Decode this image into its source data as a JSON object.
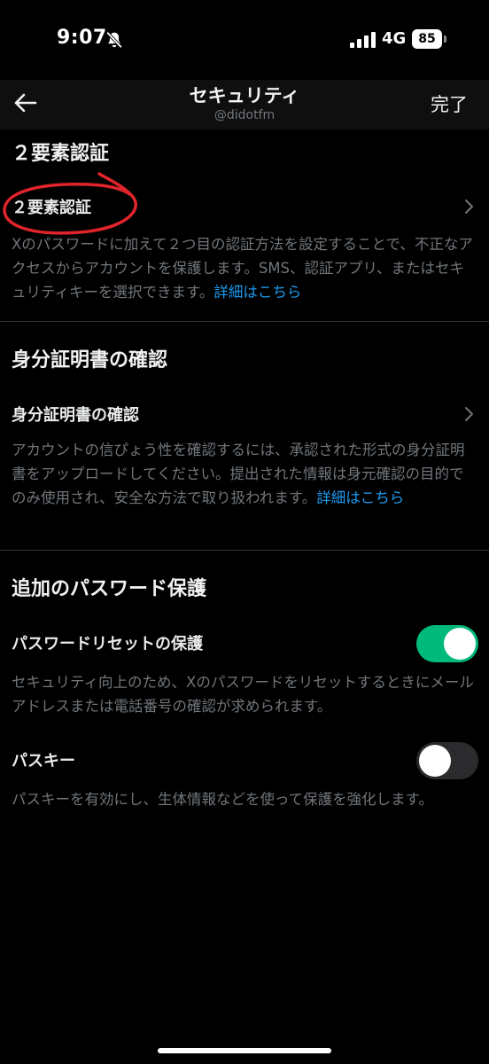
{
  "status_bar": {
    "time": "9:07",
    "network": "4G",
    "battery": "85"
  },
  "header": {
    "title": "セキュリティ",
    "username": "@didotfm",
    "done_label": "完了",
    "back_icon": "arrow-left-icon"
  },
  "two_factor": {
    "section_title": "２要素認証",
    "row_label": "２要素認証",
    "description": "Xのパスワードに加えて２つ目の認証方法を設定することで、不正なアクセスからアカウントを保護します。SMS、認証アプリ、またはセキュリティキーを選択できます。",
    "link": "詳細はこちら"
  },
  "id_verification": {
    "section_title": "身分証明書の確認",
    "row_label": "身分証明書の確認",
    "description": "アカウントの信ぴょう性を確認するには、承認された形式の身分証明書をアップロードしてください。提出された情報は身元確認の目的でのみ使用され、安全な方法で取り扱われます。",
    "link": "詳細はこちら"
  },
  "password_protection": {
    "section_title": "追加のパスワード保護",
    "reset_protection": {
      "label": "パスワードリセットの保護",
      "description": "セキュリティ向上のため、Xのパスワードをリセットするときにメールアドレスまたは電話番号の確認が求められます。",
      "enabled": true
    },
    "passkey": {
      "label": "パスキー",
      "description": "パスキーを有効にし、生体情報などを使って保護を強化します。",
      "enabled": false
    }
  },
  "colors": {
    "background": "#000000",
    "link": "#1d9bf0",
    "toggle_on": "#00ba7c",
    "annotation": "#e0242b"
  }
}
